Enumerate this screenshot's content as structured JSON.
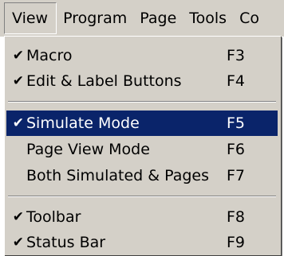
{
  "menubar": {
    "titles": [
      "View",
      "Program",
      "Page",
      "Tools",
      "Co"
    ]
  },
  "menu": {
    "items": [
      {
        "label": "Macro",
        "shortcut": "F3",
        "checked": true,
        "selected": false
      },
      {
        "label": "Edit & Label Buttons",
        "shortcut": "F4",
        "checked": true,
        "selected": false
      },
      {
        "label": "Simulate Mode",
        "shortcut": "F5",
        "checked": true,
        "selected": true
      },
      {
        "label": "Page View Mode",
        "shortcut": "F6",
        "checked": false,
        "selected": false
      },
      {
        "label": "Both Simulated & Pages",
        "shortcut": "F7",
        "checked": false,
        "selected": false
      },
      {
        "label": "Toolbar",
        "shortcut": "F8",
        "checked": true,
        "selected": false
      },
      {
        "label": "Status Bar",
        "shortcut": "F9",
        "checked": true,
        "selected": false
      }
    ],
    "check_glyph": "✔"
  },
  "colors": {
    "menu_face": "#d4d0c8",
    "highlight": "#0a246a",
    "highlight_text": "#ffffff"
  }
}
